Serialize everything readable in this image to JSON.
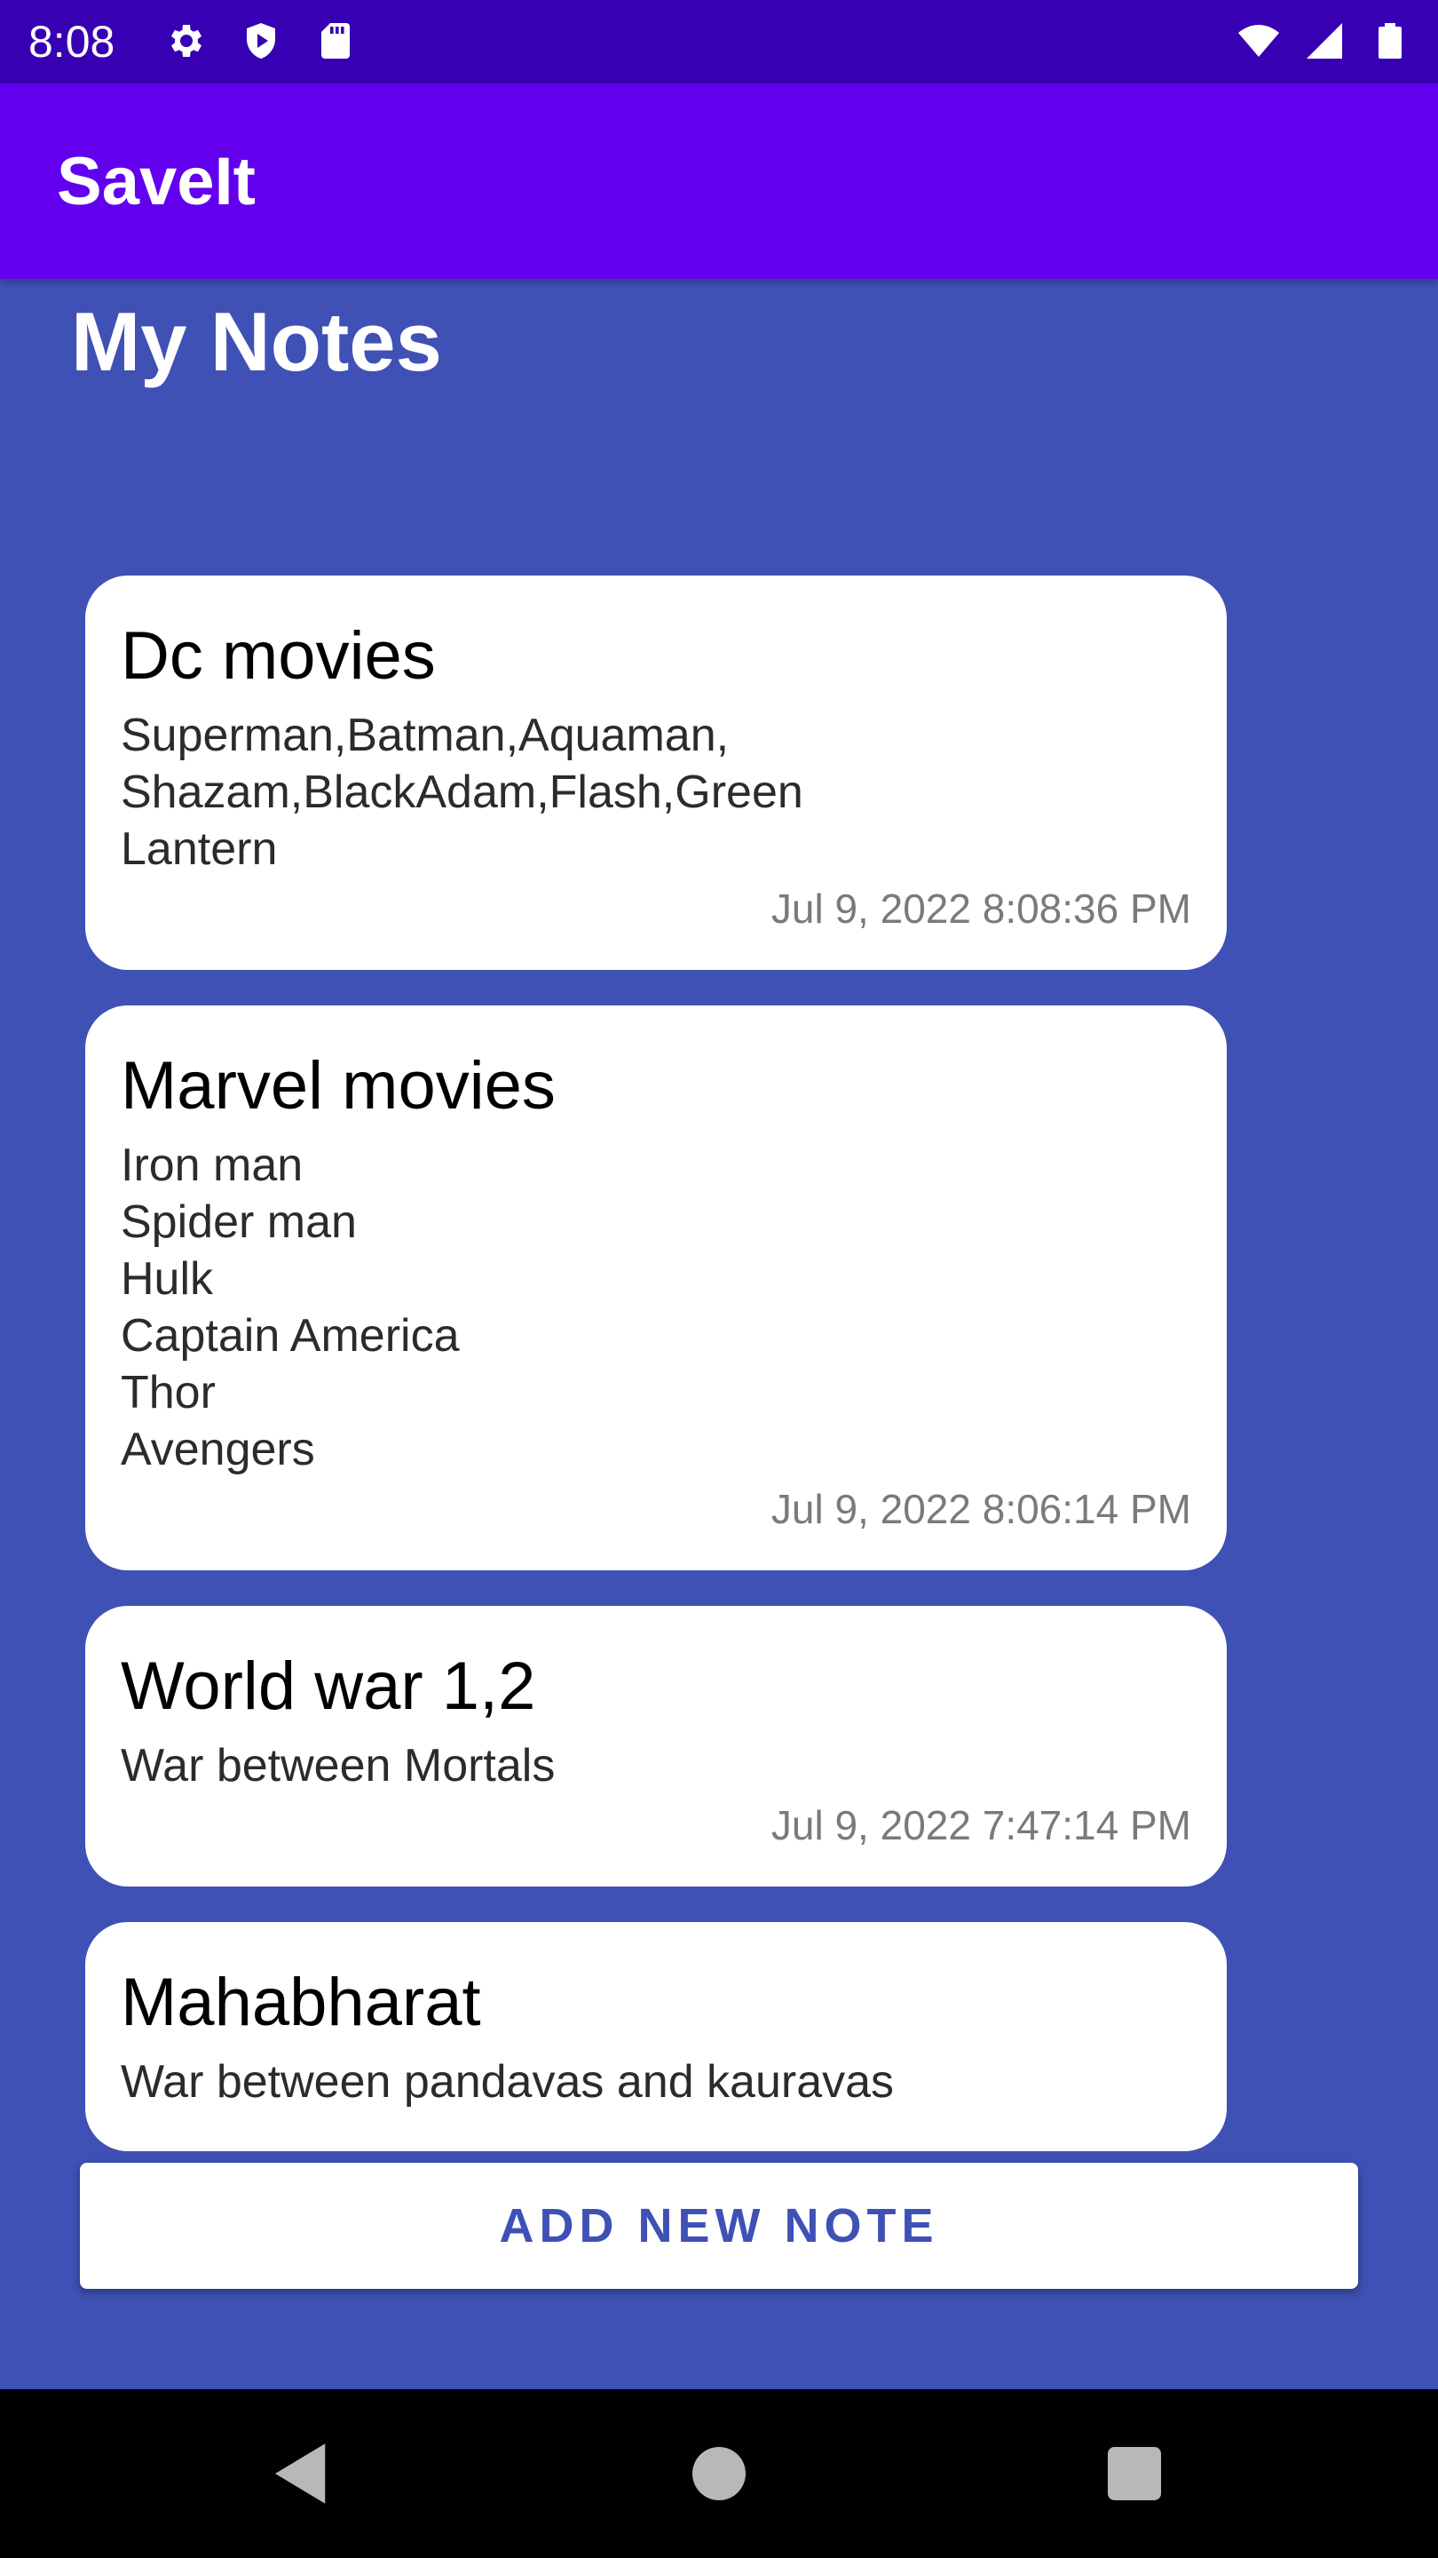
{
  "status_bar": {
    "time": "8:08",
    "left_icons": [
      "gear-icon",
      "shield-play-icon",
      "sd-card-icon"
    ],
    "right_icons": [
      "wifi-icon",
      "signal-icon",
      "battery-icon"
    ]
  },
  "app_bar": {
    "title": "SaveIt"
  },
  "page": {
    "heading": "My Notes"
  },
  "notes": [
    {
      "title": "Dc movies",
      "body": "Superman,Batman,Aquaman,\nShazam,BlackAdam,Flash,Green\nLantern",
      "date": "Jul 9, 2022 8:08:36 PM"
    },
    {
      "title": "Marvel movies",
      "body": "Iron man\nSpider man\nHulk\nCaptain America\nThor\nAvengers",
      "date": "Jul 9, 2022 8:06:14 PM"
    },
    {
      "title": "World war 1,2",
      "body": "War between Mortals",
      "date": "Jul 9, 2022 7:47:14 PM"
    },
    {
      "title": "Mahabharat",
      "body": "War between pandavas and kauravas",
      "date": ""
    }
  ],
  "actions": {
    "add_new_note": "ADD NEW NOTE"
  },
  "nav_bar": {
    "icons": [
      "back-icon",
      "home-icon",
      "recents-icon"
    ]
  },
  "colors": {
    "status_bar": "#3700b3",
    "app_bar": "#6200ee",
    "background": "#3f51b5",
    "card": "#ffffff",
    "button_text": "#3f51b5"
  }
}
